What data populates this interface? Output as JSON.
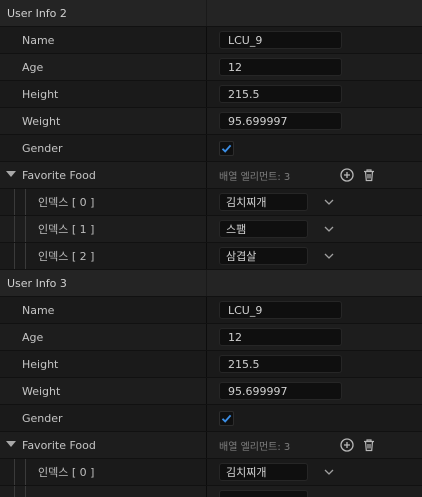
{
  "sections": [
    {
      "title": "User Info 2",
      "name": {
        "label": "Name",
        "value": "LCU_9"
      },
      "age": {
        "label": "Age",
        "value": "12"
      },
      "height": {
        "label": "Height",
        "value": "215.5"
      },
      "weight": {
        "label": "Weight",
        "value": "95.699997"
      },
      "gender": {
        "label": "Gender",
        "checked": true
      },
      "food": {
        "label": "Favorite Food",
        "count_text": "배열 엘리먼트: 3",
        "items": [
          {
            "index": "인덱스 [ 0 ]",
            "value": "김치찌개"
          },
          {
            "index": "인덱스 [ 1 ]",
            "value": "스팸"
          },
          {
            "index": "인덱스 [ 2 ]",
            "value": "삼겹살"
          }
        ]
      }
    },
    {
      "title": "User Info 3",
      "name": {
        "label": "Name",
        "value": "LCU_9"
      },
      "age": {
        "label": "Age",
        "value": "12"
      },
      "height": {
        "label": "Height",
        "value": "215.5"
      },
      "weight": {
        "label": "Weight",
        "value": "95.699997"
      },
      "gender": {
        "label": "Gender",
        "checked": true
      },
      "food": {
        "label": "Favorite Food",
        "count_text": "배열 엘리먼트: 3",
        "items": [
          {
            "index": "인덱스 [ 0 ]",
            "value": "김치찌개"
          }
        ]
      }
    }
  ],
  "icons": {
    "add": "plus-circle-icon",
    "remove": "trash-icon",
    "collapse": "triangle-down-icon",
    "dropdown": "chevron-down-icon",
    "check": "checkmark-icon"
  },
  "colors": {
    "check_accent": "#3b8ee6",
    "background": "#151515",
    "category": "#242424"
  }
}
